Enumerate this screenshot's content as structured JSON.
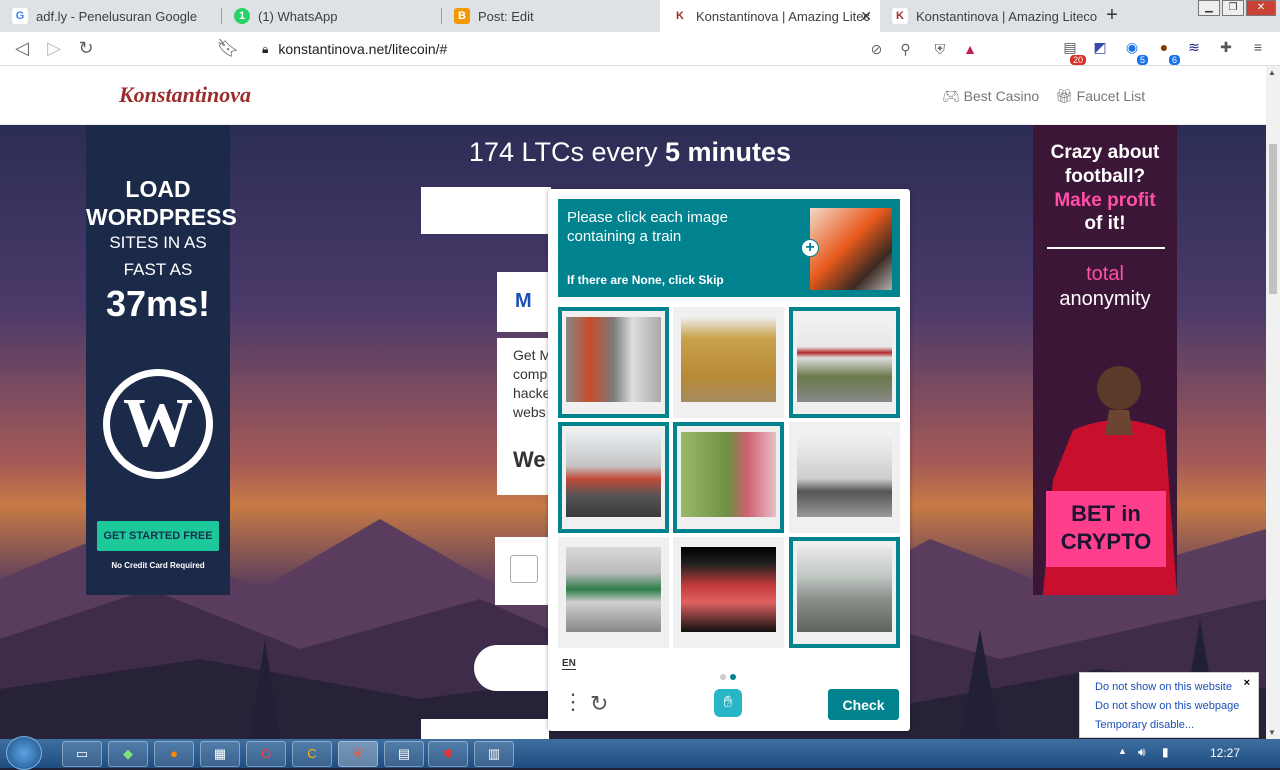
{
  "tabs": [
    {
      "label": "adf.ly - Penelusuran Google",
      "favicon": "G",
      "color": "#4285f4"
    },
    {
      "label": "(1) WhatsApp",
      "favicon": "1",
      "color": "#25d366"
    },
    {
      "label": "Post: Edit",
      "favicon": "B",
      "color": "#f29900"
    },
    {
      "label": "Konstantinova | Amazing Litec",
      "favicon": "K",
      "color": "#9b2d2d",
      "active": true
    },
    {
      "label": "Konstantinova | Amazing Litecoin",
      "favicon": "K",
      "color": "#9b2d2d"
    }
  ],
  "toolbar": {
    "url": "konstantinova.net/litecoin/#",
    "ext_badge_1": "20",
    "ext_badge_2": "5",
    "ext_badge_3": "6"
  },
  "site": {
    "logo": "Konstantinova",
    "nav": [
      "Best Casino",
      "Faucet List"
    ]
  },
  "headline": {
    "prefix": "174 LTCs every ",
    "bold": "5 minutes"
  },
  "left_ad": {
    "line1": "LOAD WORDPRESS",
    "line2": "SITES IN AS FAST AS",
    "line3": "37ms!",
    "logo": "W",
    "button": "GET STARTED FREE",
    "note": "No Credit Card Required"
  },
  "right_ad": {
    "line1": "Crazy about football?",
    "line2": "Make profit",
    "line3": "of it!",
    "line4": "total",
    "line5": "anonymity",
    "cta": "BET in CRYPTO"
  },
  "behind": {
    "logo": "M",
    "text": [
      "Get M",
      "comp",
      "hacke",
      "webs"
    ],
    "heading": "We"
  },
  "captcha": {
    "title": "Please click each image containing a train",
    "subtitle": "If there are None, click Skip",
    "cells": [
      {
        "label": "train-platform",
        "selected": true
      },
      {
        "label": "yellow-bus",
        "selected": false
      },
      {
        "label": "train-side",
        "selected": true
      },
      {
        "label": "train-front",
        "selected": true
      },
      {
        "label": "train-window-view",
        "selected": true
      },
      {
        "label": "truck",
        "selected": false
      },
      {
        "label": "train-station",
        "selected": false
      },
      {
        "label": "car-interior",
        "selected": false
      },
      {
        "label": "train-depot",
        "selected": true
      }
    ],
    "lang": "EN",
    "check_label": "Check"
  },
  "popup": {
    "items": [
      "Do not show on this website",
      "Do not show on this webpage",
      "Temporary disable..."
    ],
    "close": "×"
  },
  "taskbar": {
    "time": "12:27"
  }
}
